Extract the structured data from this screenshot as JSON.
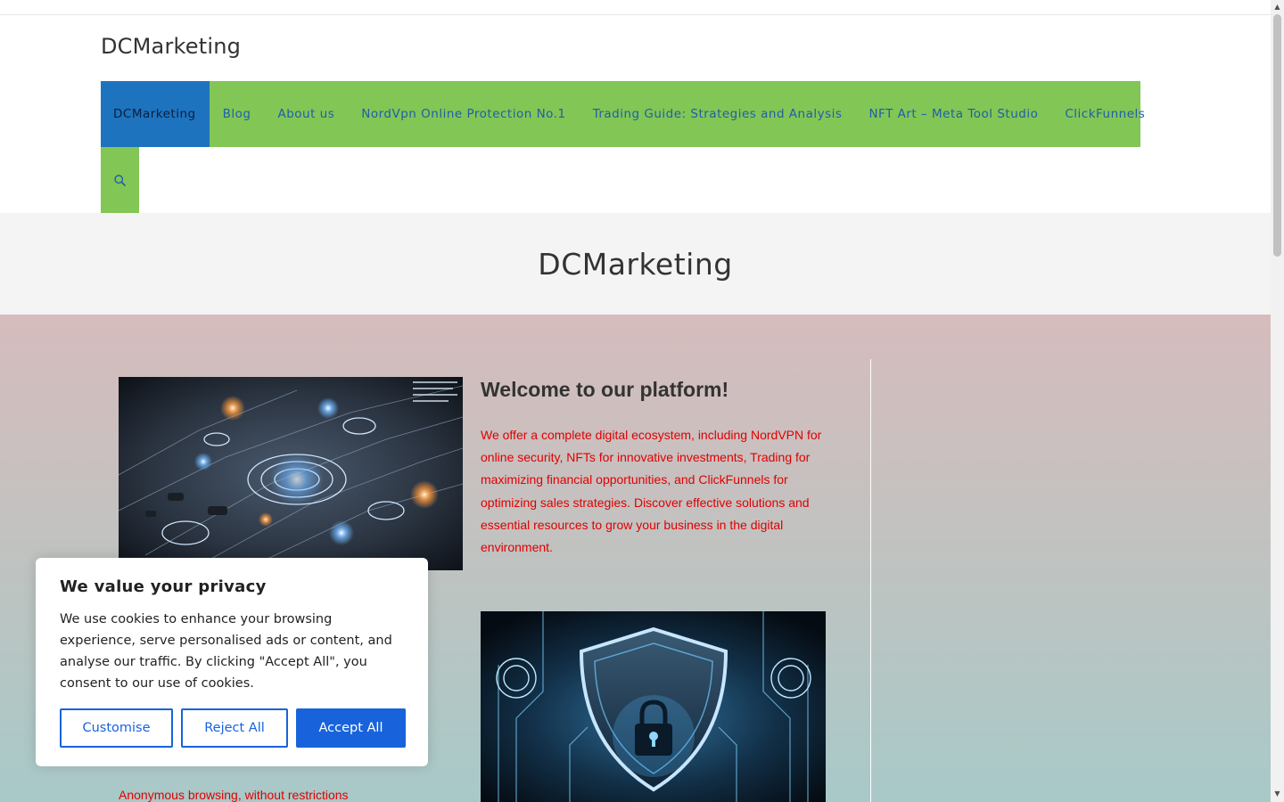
{
  "site": {
    "title": "DCMarketing"
  },
  "nav": {
    "items": [
      {
        "label": "DCMarketing",
        "active": true
      },
      {
        "label": "Blog"
      },
      {
        "label": "About us"
      },
      {
        "label": "NordVpn Online Protection No.1"
      },
      {
        "label": "Trading Guide: Strategies and Analysis"
      },
      {
        "label": "NFT Art – Meta Tool Studio"
      },
      {
        "label": "ClickFunnels"
      }
    ],
    "search_icon": "search-icon"
  },
  "page_header": {
    "title": "DCMarketing"
  },
  "main": {
    "welcome_title": "Welcome to our platform!",
    "welcome_text": "We offer a complete digital ecosystem, including NordVPN for online security, NFTs for innovative investments, Trading for maximizing financial opportunities, and ClickFunnels for optimizing sales strategies. Discover effective solutions and essential resources to grow your business in the digital environment.",
    "anon_text": "Anonymous browsing, without restrictions"
  },
  "cookie": {
    "title": "We value your privacy",
    "text": "We use cookies to enhance your browsing experience, serve personalised ads or content, and analyse our traffic. By clicking \"Accept All\", you consent to our use of cookies.",
    "customise_label": "Customise",
    "reject_label": "Reject All",
    "accept_label": "Accept All"
  },
  "colors": {
    "nav_bg": "#82c655",
    "nav_active_bg": "#1e73be",
    "nav_link": "#1e5faa",
    "accent_red": "#e00000",
    "cookie_button": "#1863dc"
  }
}
